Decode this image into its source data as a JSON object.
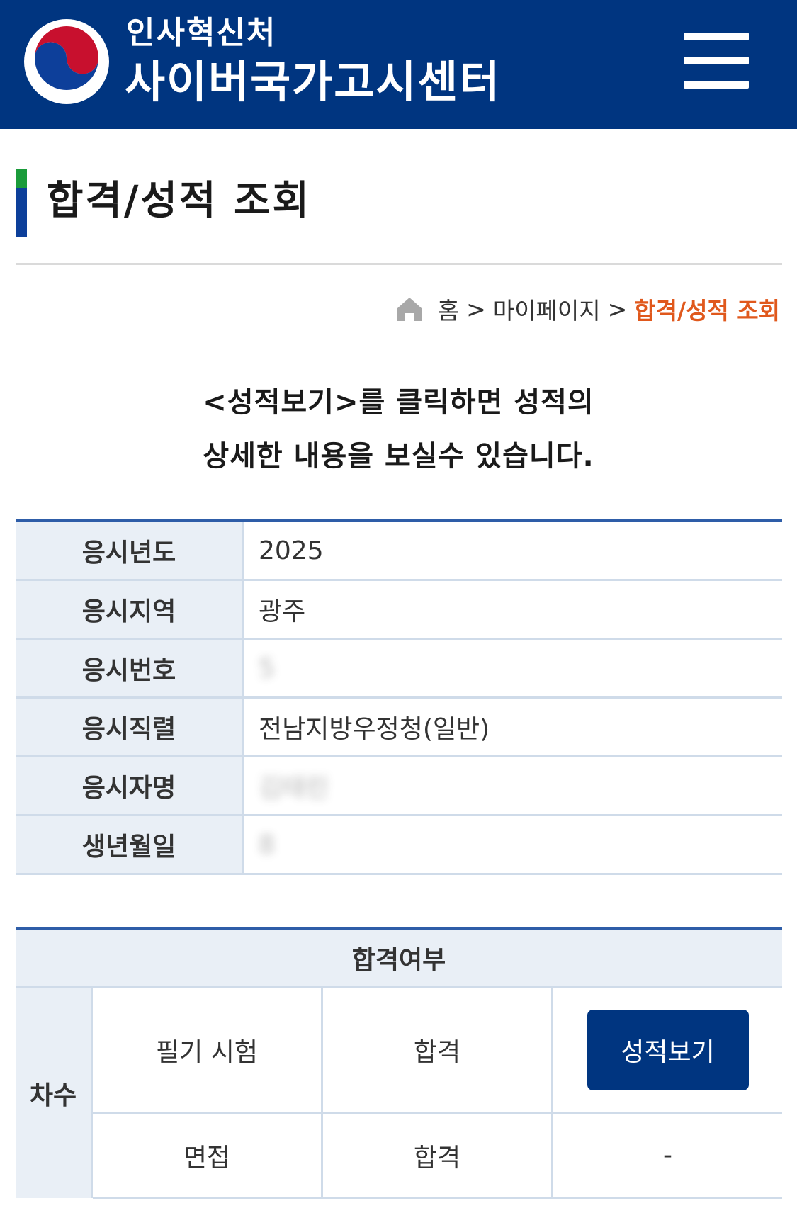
{
  "header": {
    "org_name": "인사혁신처",
    "site_name": "사이버국가고시센터"
  },
  "page": {
    "title": "합격/성적 조회"
  },
  "breadcrumb": {
    "home": "홈",
    "separator": ">",
    "mypage": "마이페이지",
    "current": "합격/성적 조회"
  },
  "notice": {
    "line1": "<성적보기>를 클릭하면 성적의",
    "line2": "상세한 내용을 보실수 있습니다."
  },
  "info": {
    "rows": [
      {
        "label": "응시년도",
        "value": "2025"
      },
      {
        "label": "응시지역",
        "value": "광주"
      },
      {
        "label": "응시번호",
        "value": "5"
      },
      {
        "label": "응시직렬",
        "value": "전남지방우정청(일반)"
      },
      {
        "label": "응시자명",
        "value": "김태린"
      },
      {
        "label": "생년월일",
        "value": "8"
      }
    ]
  },
  "result": {
    "header": "합격여부",
    "round_label": "차수",
    "rows": [
      {
        "exam": "필기 시험",
        "status": "합격",
        "action": "성적보기"
      },
      {
        "exam": "면접",
        "status": "합격",
        "action": "-"
      }
    ]
  },
  "colors": {
    "header_bg": "#003580",
    "accent_orange": "#e0581c",
    "table_border": "#2e5da8",
    "label_bg": "#e9eff6"
  }
}
